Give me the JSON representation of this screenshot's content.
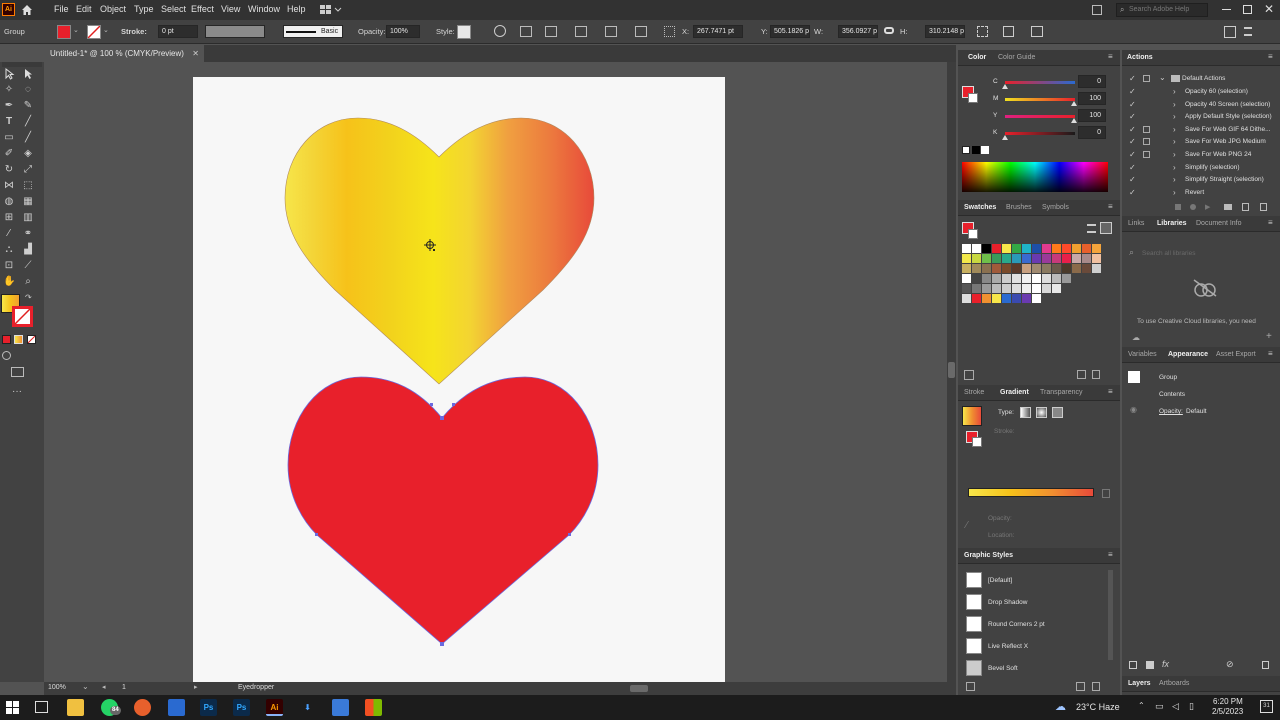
{
  "menubar": {
    "app_logo": "Ai",
    "items": [
      "File",
      "Edit",
      "Object",
      "Type",
      "Select",
      "Effect",
      "View",
      "Window",
      "Help"
    ],
    "search_placeholder": "Search Adobe Help"
  },
  "control": {
    "selection_label": "Group",
    "stroke_label": "Stroke:",
    "stroke_value": "0 pt",
    "brush_label": "Basic",
    "opacity_label": "Opacity:",
    "opacity_value": "100%",
    "style_label": "Style:",
    "x_label": "X:",
    "x_value": "267.7471 pt",
    "y_label": "Y:",
    "y_value": "505.1826 pt",
    "w_label": "W:",
    "w_value": "356.0927 pt",
    "h_label": "H:",
    "h_value": "310.2148 pt"
  },
  "document": {
    "tab_title": "Untitled-1* @ 100 % (CMYK/Preview)"
  },
  "status": {
    "zoom": "100%",
    "artboard": "1",
    "tool": "Eyedropper"
  },
  "color_panel": {
    "tabs": [
      "Color",
      "Color Guide"
    ],
    "channels": [
      {
        "label": "C",
        "value": "0"
      },
      {
        "label": "M",
        "value": "100"
      },
      {
        "label": "Y",
        "value": "100"
      },
      {
        "label": "K",
        "value": "0"
      }
    ]
  },
  "swatches_panel": {
    "tabs": [
      "Swatches",
      "Brushes",
      "Symbols"
    ]
  },
  "gradient_panel": {
    "tabs": [
      "Stroke",
      "Gradient",
      "Transparency"
    ],
    "type_label": "Type:",
    "stroke_label": "Stroke:",
    "opacity_label": "Opacity:",
    "location_label": "Location:"
  },
  "graphic_styles": {
    "title": "Graphic Styles",
    "items": [
      "[Default]",
      "Drop Shadow",
      "Round Corners 2 pt",
      "Live Reflect X",
      "Bevel Soft"
    ]
  },
  "actions_panel": {
    "title": "Actions",
    "set_name": "Default Actions",
    "items": [
      "Opacity 60 (selection)",
      "Opacity 40 Screen (selection)",
      "Apply Default Style (selection)",
      "Save For Web GIF 64 Dithe...",
      "Save For Web JPG Medium",
      "Save For Web PNG 24",
      "Simplify (selection)",
      "Simplify Straight (selection)",
      "Revert"
    ]
  },
  "libraries_panel": {
    "tabs": [
      "Links",
      "Libraries",
      "Document Info"
    ],
    "search_placeholder": "Search all libraries",
    "message": "To use Creative Cloud libraries, you need"
  },
  "appearance_panel": {
    "tabs": [
      "Variables",
      "Appearance",
      "Asset Export"
    ],
    "object_name": "Group",
    "contents_label": "Contents",
    "opacity_label": "Opacity:",
    "opacity_value": "Default"
  },
  "layers_panel": {
    "tabs": [
      "Layers",
      "Artboards"
    ]
  },
  "taskbar": {
    "weather": "23°C  Haze",
    "time": "6:20 PM",
    "date": "2/5/2023",
    "whatsapp_badge": "84",
    "notif_count": "31"
  },
  "colors": {
    "heart_red": "#e8202b",
    "gradient_start": "#f7e64a",
    "gradient_mid": "#f6e41a",
    "gradient_end": "#e84a3a",
    "fill_swatch": "#e8202b",
    "ui_dark": "#323232",
    "ui_panel": "#424242"
  }
}
